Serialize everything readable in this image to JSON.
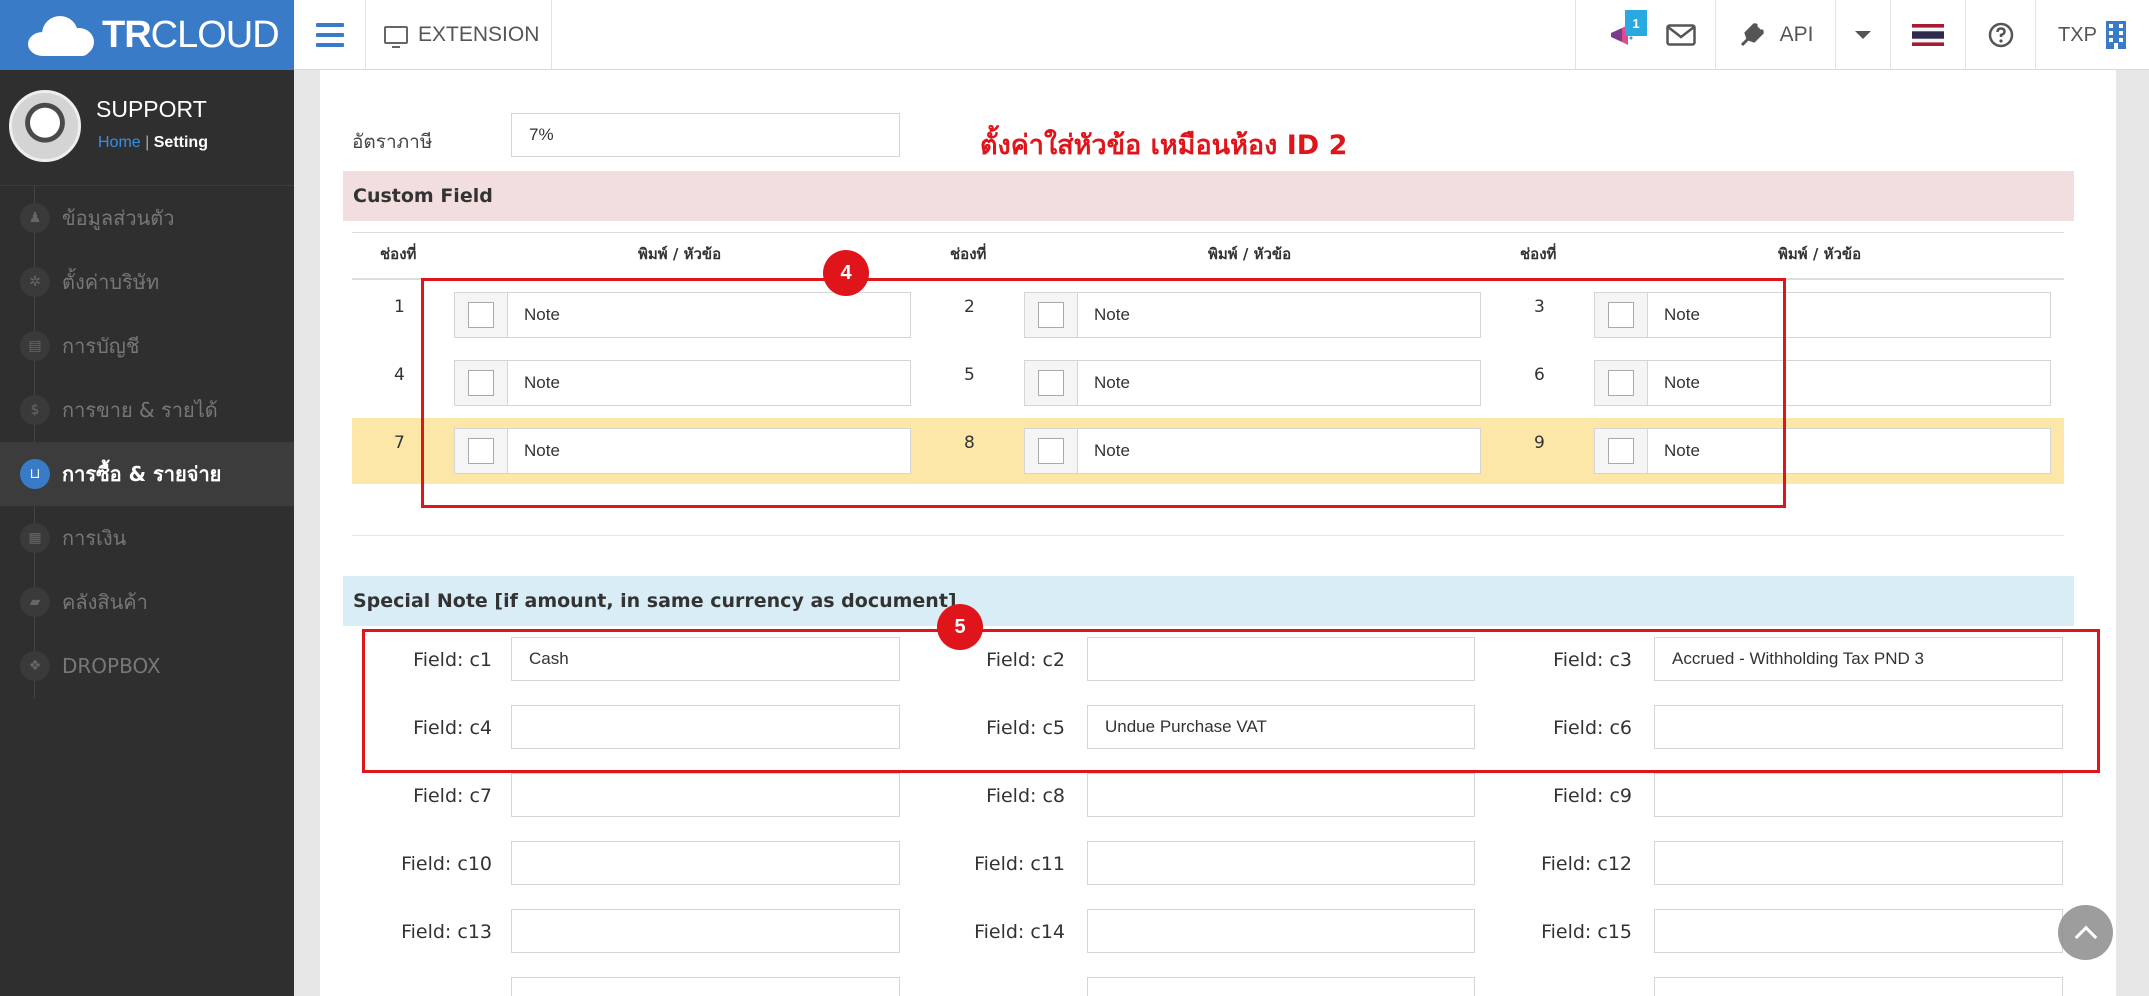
{
  "topbar": {
    "logo_bold": "TR",
    "logo_light": "CLOUD",
    "extension_label": "EXTENSION",
    "notify_badge": "1",
    "api_label": "API",
    "user_label": "TXP"
  },
  "sidebar": {
    "profile_name": "SUPPORT",
    "crumb_home": "Home",
    "crumb_sep": "|",
    "crumb_current": "Setting",
    "items": [
      {
        "label": "ข้อมูลส่วนตัว",
        "icon": "user-icon"
      },
      {
        "label": "ตั้งค่าบริษัท",
        "icon": "gear-icon"
      },
      {
        "label": "การบัญชี",
        "icon": "book-icon"
      },
      {
        "label": "การขาย & รายได้",
        "icon": "dollar-icon"
      },
      {
        "label": "การซื้อ & รายจ่าย",
        "icon": "cart-icon"
      },
      {
        "label": "การเงิน",
        "icon": "calendar-icon"
      },
      {
        "label": "คลังสินค้า",
        "icon": "truck-icon"
      },
      {
        "label": "DROPBOX",
        "icon": "dropbox-icon"
      }
    ]
  },
  "main": {
    "tax_label": "อัตราภาษี",
    "tax_value": "7%",
    "annotation_text": "ตั้งค่าใส่หัวข้อ เหมือนห้อง ID 2",
    "custom_field_title": "Custom Field",
    "col_slot": "ช่องที่",
    "col_print": "พิมพ์ / หัวข้อ",
    "custom_fields": [
      {
        "num": "1",
        "value": "Note"
      },
      {
        "num": "2",
        "value": "Note"
      },
      {
        "num": "3",
        "value": "Note"
      },
      {
        "num": "4",
        "value": "Note"
      },
      {
        "num": "5",
        "value": "Note"
      },
      {
        "num": "6",
        "value": "Note"
      },
      {
        "num": "7",
        "value": "Note"
      },
      {
        "num": "8",
        "value": "Note"
      },
      {
        "num": "9",
        "value": "Note"
      }
    ],
    "marker_4": "4",
    "marker_5": "5",
    "special_note_title": "Special Note [if amount, in same currency as document]",
    "special_fields": [
      {
        "label": "Field: c1",
        "value": "Cash"
      },
      {
        "label": "Field: c2",
        "value": ""
      },
      {
        "label": "Field: c3",
        "value": "Accrued - Withholding Tax PND 3"
      },
      {
        "label": "Field: c4",
        "value": ""
      },
      {
        "label": "Field: c5",
        "value": "Undue Purchase VAT"
      },
      {
        "label": "Field: c6",
        "value": ""
      },
      {
        "label": "Field: c7",
        "value": ""
      },
      {
        "label": "Field: c8",
        "value": ""
      },
      {
        "label": "Field: c9",
        "value": ""
      },
      {
        "label": "Field: c10",
        "value": ""
      },
      {
        "label": "Field: c11",
        "value": ""
      },
      {
        "label": "Field: c12",
        "value": ""
      },
      {
        "label": "Field: c13",
        "value": ""
      },
      {
        "label": "Field: c14",
        "value": ""
      },
      {
        "label": "Field: c15",
        "value": ""
      }
    ]
  }
}
